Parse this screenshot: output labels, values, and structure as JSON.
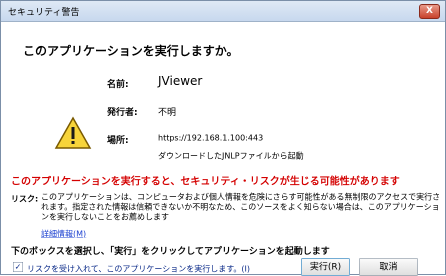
{
  "window": {
    "title": "セキュリティ警告",
    "close_label": "X"
  },
  "dialog": {
    "heading": "このアプリケーションを実行しますか。",
    "fields": [
      {
        "label": "名前:",
        "value": "JViewer"
      },
      {
        "label": "発行者:",
        "value": "不明"
      },
      {
        "label": "場所:",
        "value": "https://192.168.1.100:443"
      }
    ],
    "location_note": "ダウンロードしたJNLPファイルから起動",
    "warning": "このアプリケーションを実行すると、セキュリティ・リスクが生じる可能性があります",
    "risk_label": "リスク:",
    "risk_text": "このアプリケーションは、コンピュータおよび個人情報を危険にさらす可能性がある無制限のアクセスで実行されます。指定された情報は信頼できないか不明なため、このソースをよく知らない場合は、このアプリケーションを実行しないことをお薦めします",
    "detail_link": "詳細情報(M)",
    "instruction": "下のボックスを選択し、「実行」をクリックしてアプリケーションを起動します",
    "checkbox_label": "リスクを受け入れて、このアプリケーションを実行します。(I)",
    "checkbox_checked": true,
    "run_button": "実行(R)",
    "cancel_button": "取消",
    "warning_color": "#d40000",
    "icon": "warning-triangle-icon"
  }
}
